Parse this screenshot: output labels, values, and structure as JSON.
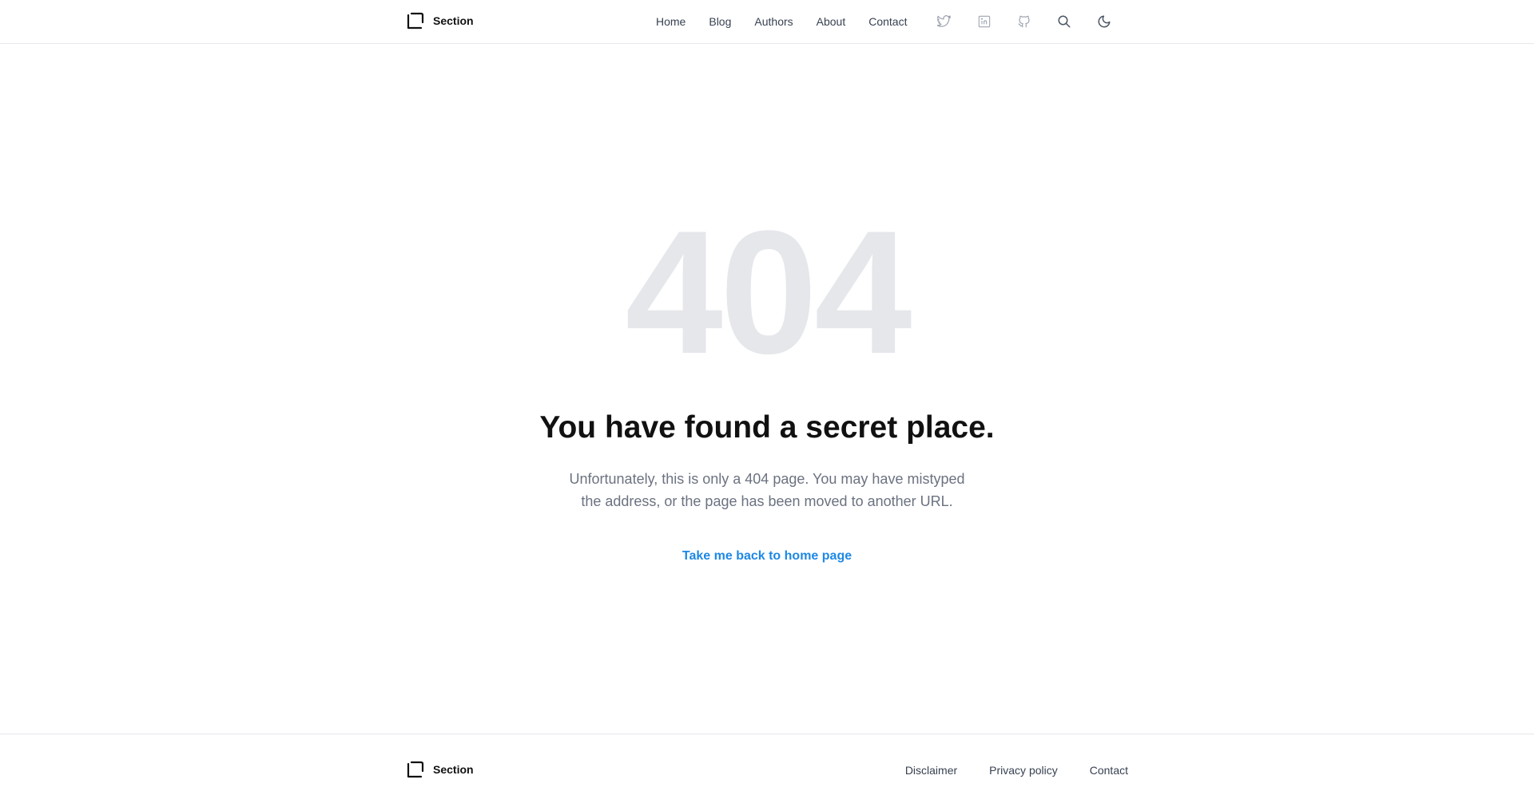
{
  "header": {
    "brand": "Section",
    "nav": [
      "Home",
      "Blog",
      "Authors",
      "About",
      "Contact"
    ],
    "icons": [
      "twitter-icon",
      "linkedin-icon",
      "github-icon",
      "search-icon",
      "moon-icon"
    ]
  },
  "main": {
    "code": "404",
    "headline": "You have found a secret place.",
    "description": "Unfortunately, this is only a 404 page. You may have mistyped the address, or the page has been moved to another URL.",
    "home_link": "Take me back to home page"
  },
  "footer": {
    "brand": "Section",
    "links": [
      "Disclaimer",
      "Privacy policy",
      "Contact"
    ]
  },
  "colors": {
    "accent": "#1e88e5",
    "code": "#e5e7eb",
    "muted": "#6b7280"
  }
}
